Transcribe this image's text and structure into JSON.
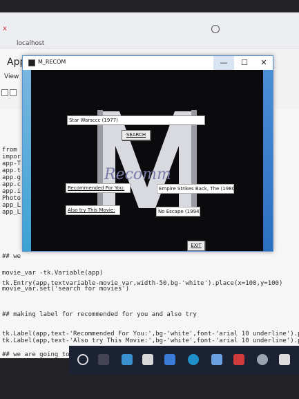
{
  "browser": {
    "address": "localhost",
    "close_glyph": "x"
  },
  "ide": {
    "app_label": "App",
    "view_tab": "View",
    "code_lines": [
      {
        "text": "from"
      },
      {
        "text": "impor"
      },
      {
        "text": "app-T"
      },
      {
        "text": "app.t"
      },
      {
        "text": "app.g"
      },
      {
        "text": "app.c"
      },
      {
        "text": "app.i"
      },
      {
        "text": "Photo"
      },
      {
        "text": "app_L"
      },
      {
        "text": "app_L"
      },
      {
        "text": "## we"
      },
      {
        "text": "movie_var -tk.Variable(app)"
      },
      {
        "text": "tk.Entry(app,textvariable-movie_var,width-50,bg-'white').place(x=100,y=100)"
      },
      {
        "text": "movie_var.set('search for movies')"
      },
      {
        "text": "## making label for recommended for you and also try"
      },
      {
        "text": "tk.Label(app,text-'Recommended For You:',bg-'white',font-'arial 10 underline').place"
      },
      {
        "text": "tk.Label(app,text-'Also try This Movie:',bg-'white',font-'arial 10 underline').place"
      },
      {
        "text": "## we are going to make the varible for recommended and also try"
      }
    ]
  },
  "tk_window": {
    "title": "M_RECOM",
    "minimize_glyph": "—",
    "maximize_glyph": "☐",
    "close_glyph": "✕",
    "logo_text": "Recomm",
    "search_entry_value": "Star Warsccc (1977)",
    "search_button": "SEARCH",
    "recommended_label": "Recommended For You:",
    "recommended_result": "Empire Strikes Back, The (1980)",
    "also_try_label": "Also try This Movie:",
    "also_try_result": "No Escape (1994)",
    "exit_button": "EXIT"
  },
  "colors": {
    "window_border": "#5a8fcf",
    "canvas_bg": "#0b0b0e",
    "string_pink": "#c2185b",
    "comment_blue": "#3d7cc9"
  }
}
